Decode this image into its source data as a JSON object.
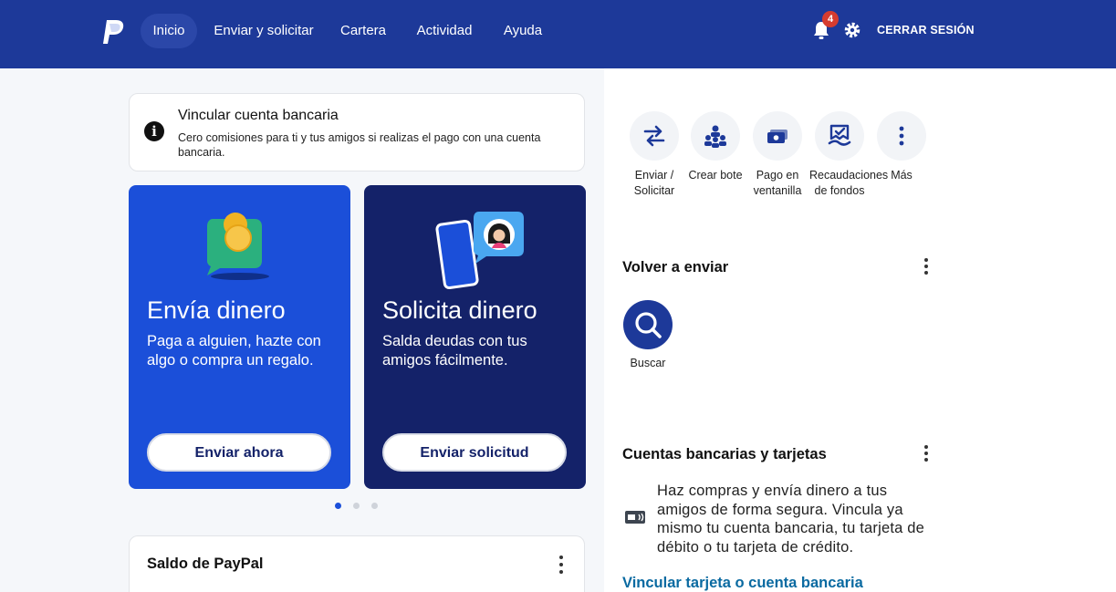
{
  "header": {
    "nav": [
      "Inicio",
      "Enviar y solicitar",
      "Cartera",
      "Actividad",
      "Ayuda"
    ],
    "notifications_count": "4",
    "logout_label": "CERRAR SESIÓN"
  },
  "info_banner": {
    "title": "Vincular cuenta bancaria",
    "description": "Cero comisiones para ti y tus amigos si realizas el pago con una cuenta bancaria."
  },
  "promos": [
    {
      "title": "Envía dinero",
      "description": "Paga a alguien, hazte con algo o compra un regalo.",
      "button": "Enviar ahora"
    },
    {
      "title": "Solicita dinero",
      "description": "Salda deudas con tus amigos fácilmente.",
      "button": "Enviar solicitud"
    }
  ],
  "carousel": {
    "total": 3,
    "active": 1
  },
  "balance": {
    "title": "Saldo de PayPal"
  },
  "quick_actions": [
    {
      "label": "Enviar / Solicitar",
      "icon": "transfer-arrows-icon"
    },
    {
      "label": "Crear bote",
      "icon": "group-icon"
    },
    {
      "label": "Pago en ventanilla",
      "icon": "cash-icon"
    },
    {
      "label": "Recaudaciones de fondos",
      "icon": "fundraiser-icon"
    },
    {
      "label": "Más",
      "icon": "more-vertical-icon"
    }
  ],
  "send_again": {
    "title": "Volver a enviar",
    "search_label": "Buscar"
  },
  "banks": {
    "title": "Cuentas bancarias y tarjetas",
    "description": "Haz compras y envía dinero a tus amigos de forma segura. Vincula ya mismo tu cuenta bancaria, tu tarjeta de débito o tu tarjeta de crédito.",
    "link": "Vincular tarjeta o cuenta bancaria"
  },
  "colors": {
    "header": "#1d3999",
    "send_card": "#1b4fd9",
    "request_card": "#142269",
    "link": "#0a6aa1"
  }
}
